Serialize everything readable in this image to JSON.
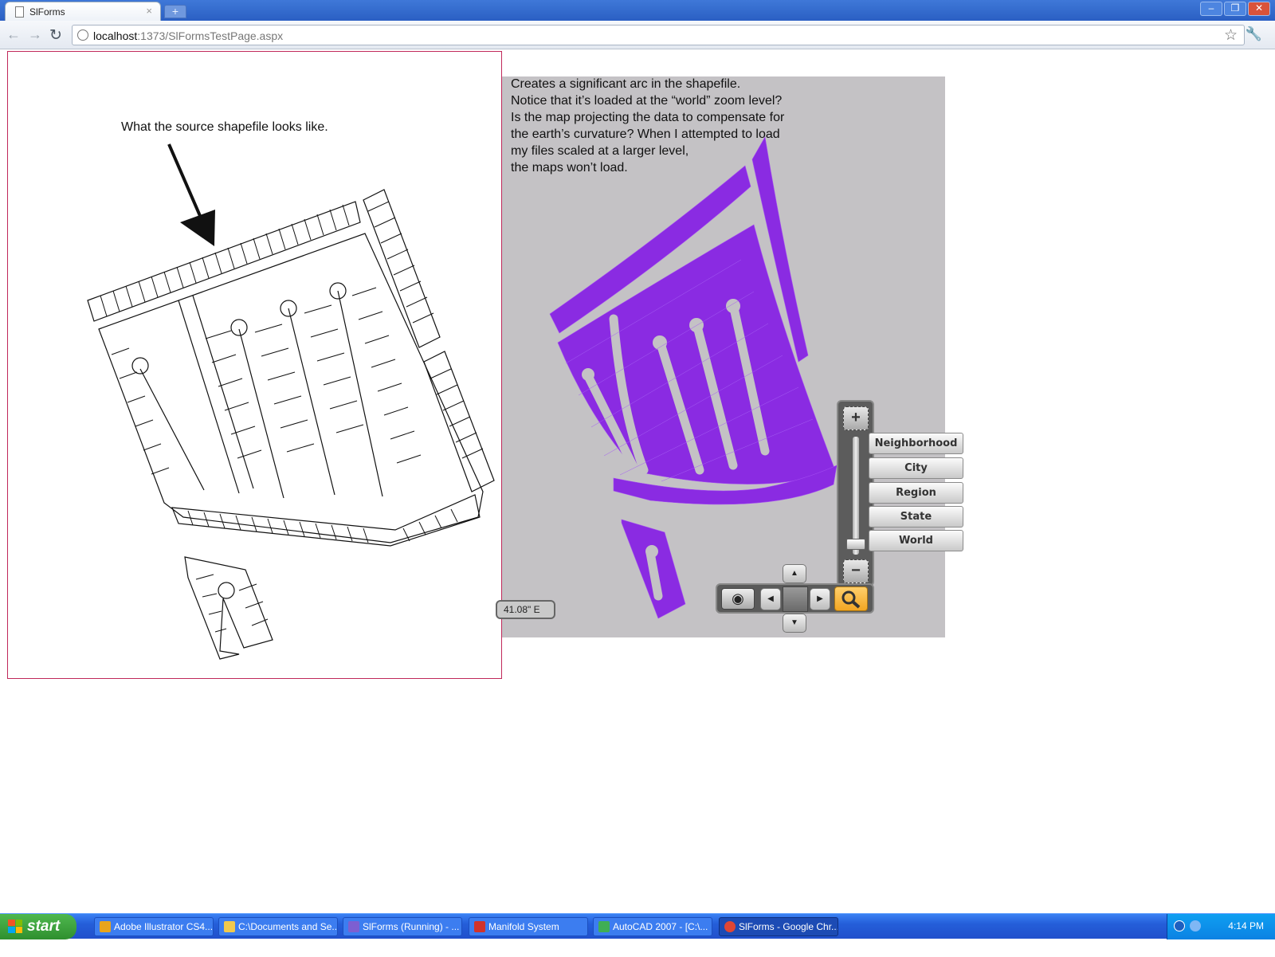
{
  "browser": {
    "tab_title": "SlForms",
    "tab_close": "×",
    "new_tab": "+",
    "url_host": "localhost",
    "url_path": ":1373/SlFormsTestPage.aspx"
  },
  "page": {
    "source_caption": "What the source shapefile looks like.",
    "map_note_lines": [
      "Creates a significant arc in the shapefile.",
      "Notice that it’s loaded at the “world” zoom level?",
      "Is the map projecting the data to compensate for",
      "the earth’s curvature?  When I attempted to load",
      "my files scaled at a larger level,",
      "the maps won’t load."
    ],
    "coordinate_readout": "41.08\" E",
    "colors": {
      "parcels": "#8a2be2",
      "map_bg": "#c4c2c5",
      "panel_border": "#c0285a"
    }
  },
  "map_controls": {
    "zoom_in": "+",
    "zoom_out": "−",
    "zoom_levels": [
      "Neighborhood",
      "City",
      "Region",
      "State",
      "World"
    ],
    "selected_zoom_level": "World",
    "nav_icons": [
      "eye-icon",
      "pan-left-icon",
      "pan-up-icon",
      "pan-down-icon",
      "pan-right-icon",
      "magnifier-icon"
    ]
  },
  "taskbar": {
    "start": "start",
    "items": [
      {
        "label": "Adobe Illustrator CS4...",
        "color": "#e8a41c"
      },
      {
        "label": "C:\\Documents and Se...",
        "color": "#f2c94c"
      },
      {
        "label": "SlForms (Running) - ...",
        "color": "#7d5fd1"
      },
      {
        "label": "Manifold System",
        "color": "#d2332b"
      },
      {
        "label": "AutoCAD 2007 - [C:\\...",
        "color": "#3fae55"
      },
      {
        "label": "SlForms - Google Chr...",
        "color": "#e04634"
      }
    ],
    "clock": "4:14 PM"
  }
}
